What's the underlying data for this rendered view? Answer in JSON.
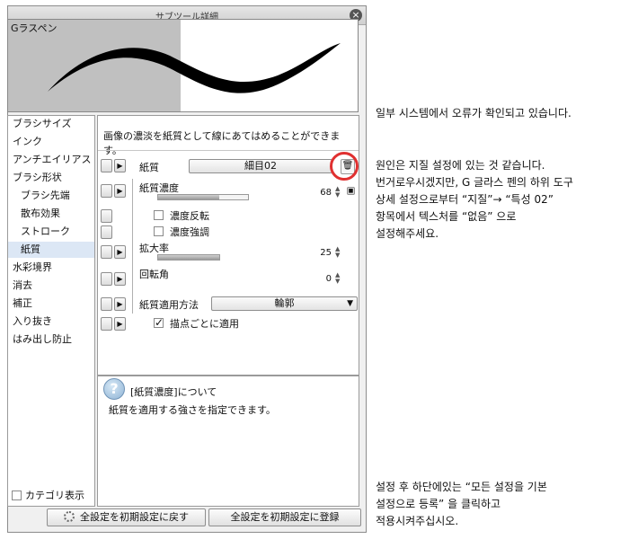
{
  "window": {
    "title": "サブツール詳細"
  },
  "preview": {
    "brush_name": "Gラスペン"
  },
  "categories": [
    {
      "label": "ブラシサイズ",
      "sub": false,
      "selected": false
    },
    {
      "label": "インク",
      "sub": false,
      "selected": false
    },
    {
      "label": "アンチエイリアス",
      "sub": false,
      "selected": false
    },
    {
      "label": "ブラシ形状",
      "sub": false,
      "selected": false
    },
    {
      "label": "ブラシ先端",
      "sub": true,
      "selected": false
    },
    {
      "label": "散布効果",
      "sub": true,
      "selected": false
    },
    {
      "label": "ストローク",
      "sub": true,
      "selected": false
    },
    {
      "label": "紙質",
      "sub": true,
      "selected": true
    },
    {
      "label": "水彩境界",
      "sub": false,
      "selected": false
    },
    {
      "label": "消去",
      "sub": false,
      "selected": false
    },
    {
      "label": "補正",
      "sub": false,
      "selected": false
    },
    {
      "label": "入り抜き",
      "sub": false,
      "selected": false
    },
    {
      "label": "はみ出し防止",
      "sub": false,
      "selected": false
    }
  ],
  "category_display": {
    "label": "カテゴリ表示",
    "checked": false
  },
  "settings": {
    "description": "画像の濃淡を紙質として線にあてはめることができます。",
    "paper": {
      "label": "紙質",
      "value": "細目02"
    },
    "paper_density": {
      "label": "紙質濃度",
      "value": "68",
      "fraction": 0.68
    },
    "invert_density": {
      "label": "濃度反転",
      "checked": false
    },
    "emphasize_density": {
      "label": "濃度強調",
      "checked": false
    },
    "scale": {
      "label": "拡大率",
      "value": "25",
      "fraction": 0.25
    },
    "rotation": {
      "label": "回転角",
      "value": "0",
      "fraction": 0.0
    },
    "apply_method": {
      "label": "紙質適用方法",
      "value": "輪郭"
    },
    "per_dot": {
      "label": "描点ごとに適用",
      "checked": true
    }
  },
  "help": {
    "title": "[紙質濃度]について",
    "body": "紙質を適用する強さを指定できます。"
  },
  "buttons": {
    "reset": "全設定を初期設定に戻す",
    "register": "全設定を初期設定に登録"
  },
  "notes": {
    "note1": "일부 시스템에서 오류가 확인되고 있습니다.",
    "note2": "원인은 지질 설정에 있는 것 같습니다.\n번거로우시겠지만, G 글라스 펜의 하위 도구\n상세 설정으로부터 “지질”→ “특성 02”\n항목에서 텍스처를 “없음” 으로\n설정해주세요.",
    "note3": "설정 후 하단에있는 “모든 설정을 기본\n설정으로 등록” 을 클릭하고\n적용시켜주십시오."
  }
}
